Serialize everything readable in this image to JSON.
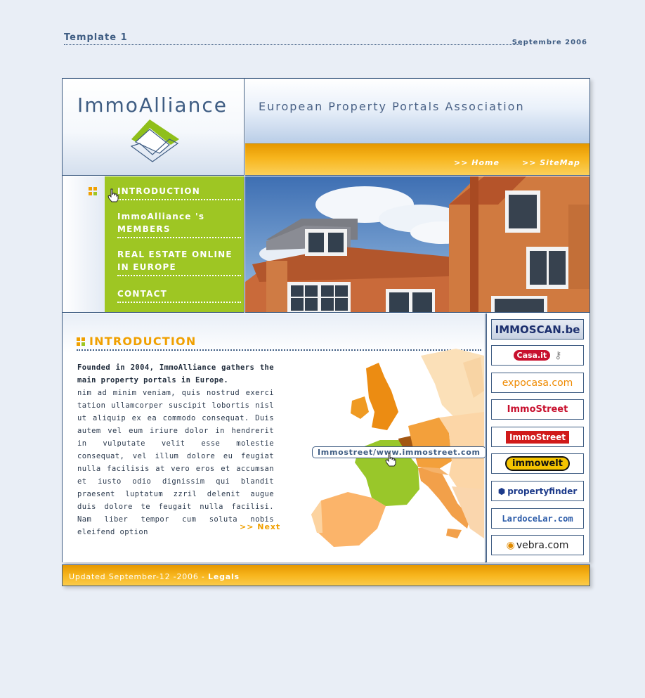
{
  "header": {
    "template_label": "Template 1",
    "date_label": "Septembre 2006"
  },
  "logo": {
    "text": "ImmoAlliance"
  },
  "banner": {
    "title": "European Property Portals Association"
  },
  "nav": {
    "home": ">> Home",
    "sitemap": ">> SiteMap"
  },
  "menu": {
    "items": [
      {
        "label": "INTRODUCTION"
      },
      {
        "label": "ImmoAlliance 's MEMBERS"
      },
      {
        "label": "REAL ESTATE ONLINE IN EUROPE"
      },
      {
        "label": "CONTACT"
      }
    ]
  },
  "content": {
    "heading": "INTRODUCTION",
    "lead": "Founded in 2004, ImmoAlliance gathers the main property portals in Europe.",
    "body": "nim ad minim veniam, quis nostrud exerci tation ullamcorper suscipit lobortis nisl ut aliquip ex ea commodo consequat. Duis autem vel eum iriure dolor in hendrerit in vulputate velit esse molestie consequat, vel illum dolore eu feugiat nulla facilisis at vero eros et accumsan et iusto odio dignissim qui blandit praesent luptatum zzril delenit augue duis dolore te feugait nulla facilisi. Nam liber tempor cum soluta nobis eleifend option",
    "next_link": ">> Next",
    "map_label": "Immostreet/www.immostreet.com"
  },
  "partners": [
    {
      "name": "IMMOSCAN.be"
    },
    {
      "name": "Casa.it"
    },
    {
      "name": "expocasa.com"
    },
    {
      "name": "ImmoStreet"
    },
    {
      "name": "ImmoStreet"
    },
    {
      "name": "immowelt"
    },
    {
      "name": "propertyfinder"
    },
    {
      "name": "LardoceLar.com"
    },
    {
      "name": "vebra.com"
    }
  ],
  "footer": {
    "updated": "Updated September-12 -2006 - ",
    "legals": "Legals"
  },
  "colors": {
    "accent_orange": "#f0a000",
    "accent_green": "#9ec623",
    "navy": "#3f5d83",
    "background": "#e9eef6"
  }
}
